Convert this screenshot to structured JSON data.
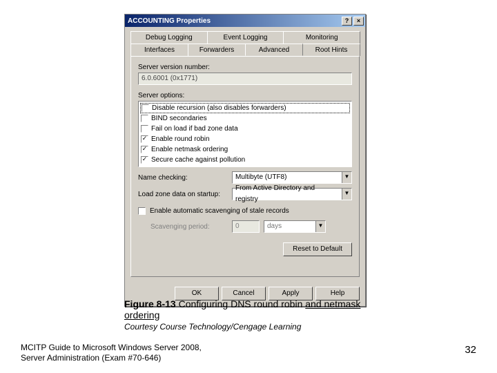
{
  "dialog": {
    "title": "ACCOUNTING Properties",
    "help_btn": "?",
    "close_btn": "×",
    "tabs_row1": [
      "Debug Logging",
      "Event Logging",
      "Monitoring"
    ],
    "tabs_row2": [
      "Interfaces",
      "Forwarders",
      "Advanced",
      "Root Hints"
    ],
    "active_tab": "Advanced",
    "version_label": "Server version number:",
    "version_value": "6.0.6001 (0x1771)",
    "options_label": "Server options:",
    "options": [
      {
        "label": "Disable recursion (also disables forwarders)",
        "checked": false,
        "selected": true
      },
      {
        "label": "BIND secondaries",
        "checked": false,
        "selected": false
      },
      {
        "label": "Fail on load if bad zone data",
        "checked": false,
        "selected": false
      },
      {
        "label": "Enable round robin",
        "checked": true,
        "selected": false
      },
      {
        "label": "Enable netmask ordering",
        "checked": true,
        "selected": false
      },
      {
        "label": "Secure cache against pollution",
        "checked": true,
        "selected": false
      }
    ],
    "name_checking_label": "Name checking:",
    "name_checking_value": "Multibyte (UTF8)",
    "load_zone_label": "Load zone data on startup:",
    "load_zone_value": "From Active Directory and registry",
    "scavenging_checkbox_label": "Enable automatic scavenging of stale records",
    "scavenging_checked": false,
    "scavenging_period_label": "Scavenging period:",
    "scavenging_value": "0",
    "scavenging_unit": "days",
    "reset_button": "Reset to Default",
    "buttons": {
      "ok": "OK",
      "cancel": "Cancel",
      "apply": "Apply",
      "help": "Help"
    }
  },
  "caption": {
    "figure_bold": "Figure 8-13",
    "figure_rest": " Configuring DNS round robin and netmask ordering",
    "courtesy": "Courtesy Course Technology/Cengage Learning"
  },
  "footer": {
    "line1": "MCITP Guide to Microsoft Windows Server 2008,",
    "line2": "Server Administration (Exam #70-646)",
    "page": "32"
  }
}
